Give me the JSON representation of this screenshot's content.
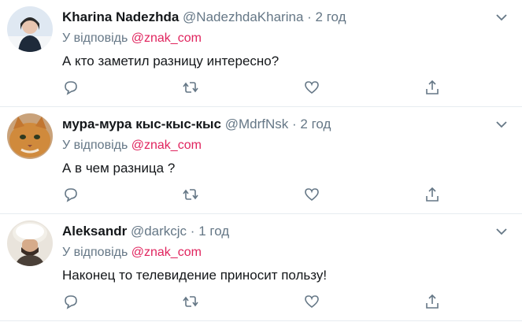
{
  "colors": {
    "mention": "#e0245e",
    "secondary": "#657786",
    "icon": "#657786"
  },
  "tweets": [
    {
      "name": "Kharina Nadezhda",
      "handle": "@NadezhdaKharina",
      "dot": "·",
      "time": "2 год",
      "reply_prefix": "У відповідь",
      "mention": "@znak_com",
      "text": "А кто заметил разницу интересно?",
      "avatar": "woman-winter-portrait"
    },
    {
      "name": "мура-мура кыс-кыс-кыс",
      "handle": "@MdrfNsk",
      "dot": "·",
      "time": "2 год",
      "reply_prefix": "У відповідь",
      "mention": "@znak_com",
      "text": "А в чем разница ?",
      "avatar": "ginger-cat"
    },
    {
      "name": "Aleksandr",
      "handle": "@darkcjc",
      "dot": "·",
      "time": "1 год",
      "reply_prefix": "У відповідь",
      "mention": "@znak_com",
      "text": "Наконец то телевидение приносит пользу!",
      "avatar": "man-fur-hat"
    }
  ],
  "icons": [
    "reply-icon",
    "retweet-icon",
    "like-icon",
    "share-icon",
    "caret-down-icon"
  ]
}
